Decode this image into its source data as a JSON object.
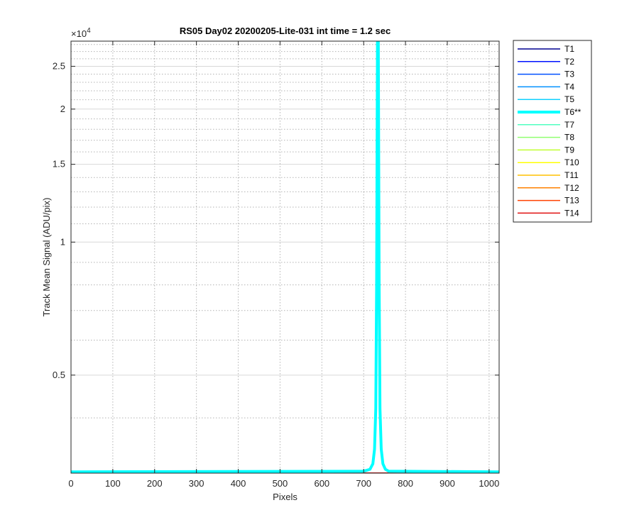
{
  "chart_data": {
    "type": "line",
    "title": "RS05 Day02 20200205-Lite-031 int time = 1.2 sec",
    "xlabel": "Pixels",
    "ylabel": "Track Mean Signal (ADU/pix)",
    "y_multiplier_label": "×10",
    "y_multiplier_exponent": "4",
    "y_scale": "log",
    "xlim": [
      0,
      1024
    ],
    "ylim": [
      3000,
      28500
    ],
    "x_ticks": [
      0,
      100,
      200,
      300,
      400,
      500,
      600,
      700,
      800,
      900,
      1000
    ],
    "x_tick_labels": [
      "0",
      "100",
      "200",
      "300",
      "400",
      "500",
      "600",
      "700",
      "800",
      "900",
      "1000"
    ],
    "y_ticks": [
      5000,
      10000,
      15000,
      20000,
      25000
    ],
    "y_tick_labels": [
      "0.5",
      "1",
      "1.5",
      "2",
      "2.5"
    ],
    "grid": true,
    "legend_position": "outside-right",
    "series": [
      {
        "name": "T1",
        "color": "#00008f",
        "x": [
          0,
          1024
        ],
        "y": [
          3005,
          3005
        ]
      },
      {
        "name": "T2",
        "color": "#0010ff",
        "x": [
          0,
          1024
        ],
        "y": [
          3005,
          3005
        ]
      },
      {
        "name": "T3",
        "color": "#0050ff",
        "x": [
          0,
          1024
        ],
        "y": [
          3005,
          3005
        ]
      },
      {
        "name": "T4",
        "color": "#0090ff",
        "x": [
          0,
          1024
        ],
        "y": [
          3005,
          3005
        ]
      },
      {
        "name": "T5",
        "color": "#10d0ff",
        "x": [
          0,
          1024
        ],
        "y": [
          3005,
          3005
        ]
      },
      {
        "name": "T6**",
        "color": "#00ffff",
        "highlight": true,
        "x": [
          0,
          700,
          715,
          722,
          726,
          729,
          731,
          733,
          735,
          737,
          739,
          742,
          746,
          752,
          760,
          1024
        ],
        "y": [
          3020,
          3030,
          3060,
          3150,
          3400,
          4200,
          8000,
          28500,
          28500,
          8000,
          4200,
          3400,
          3150,
          3060,
          3030,
          3020
        ]
      },
      {
        "name": "T7",
        "color": "#50ffc0",
        "x": [
          0,
          1024
        ],
        "y": [
          3005,
          3005
        ]
      },
      {
        "name": "T8",
        "color": "#90ff70",
        "x": [
          0,
          1024
        ],
        "y": [
          3005,
          3005
        ]
      },
      {
        "name": "T9",
        "color": "#c0ff30",
        "x": [
          0,
          1024
        ],
        "y": [
          3005,
          3005
        ]
      },
      {
        "name": "T10",
        "color": "#ffff00",
        "x": [
          0,
          1024
        ],
        "y": [
          3005,
          3005
        ]
      },
      {
        "name": "T11",
        "color": "#ffc000",
        "x": [
          0,
          1024
        ],
        "y": [
          3005,
          3005
        ]
      },
      {
        "name": "T12",
        "color": "#ff8000",
        "x": [
          0,
          1024
        ],
        "y": [
          3005,
          3005
        ]
      },
      {
        "name": "T13",
        "color": "#ff4000",
        "x": [
          0,
          1024
        ],
        "y": [
          3005,
          3005
        ]
      },
      {
        "name": "T14",
        "color": "#e01010",
        "x": [
          0,
          1024
        ],
        "y": [
          3005,
          3005
        ]
      }
    ]
  }
}
